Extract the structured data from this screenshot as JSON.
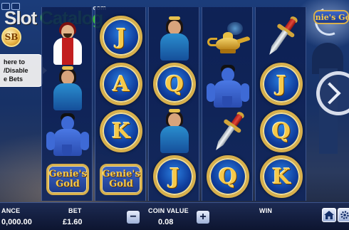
{
  "watermark": {
    "slot": "Slot",
    "catalog": "Catalog",
    "dotcom": ".com"
  },
  "left_panel": {
    "badge_label": "SB",
    "tooltip_lines": [
      "here to",
      "/Disable",
      "e Bets"
    ]
  },
  "game_title": "Genie's Gold",
  "reels": [
    [
      "man",
      "princess",
      "genie",
      "genies-gold"
    ],
    [
      "J",
      "A",
      "K",
      "genies-gold"
    ],
    [
      "princess",
      "Q",
      "princess",
      "J"
    ],
    [
      "lamp",
      "genie",
      "dagger",
      "Q"
    ],
    [
      "dagger",
      "J",
      "Q",
      "K"
    ]
  ],
  "scatter_lines": [
    "Genie's",
    "Gold"
  ],
  "bottom_bar": {
    "balance_label": "ANCE",
    "balance_value": "0,000.00",
    "bet_label": "BET",
    "bet_value": "£1.60",
    "coin_value_label": "COIN VALUE",
    "coin_value": "0.08",
    "minus_label": "−",
    "plus_label": "+",
    "win_label": "WIN"
  },
  "icons": {
    "home": "home-icon",
    "settings": "gear-icon",
    "spin": "spin-icon",
    "minus": "minus-icon",
    "plus": "plus-icon"
  },
  "colors": {
    "gold": "#d8b04c",
    "brand_green": "#3cc53c",
    "background": "#173166"
  }
}
